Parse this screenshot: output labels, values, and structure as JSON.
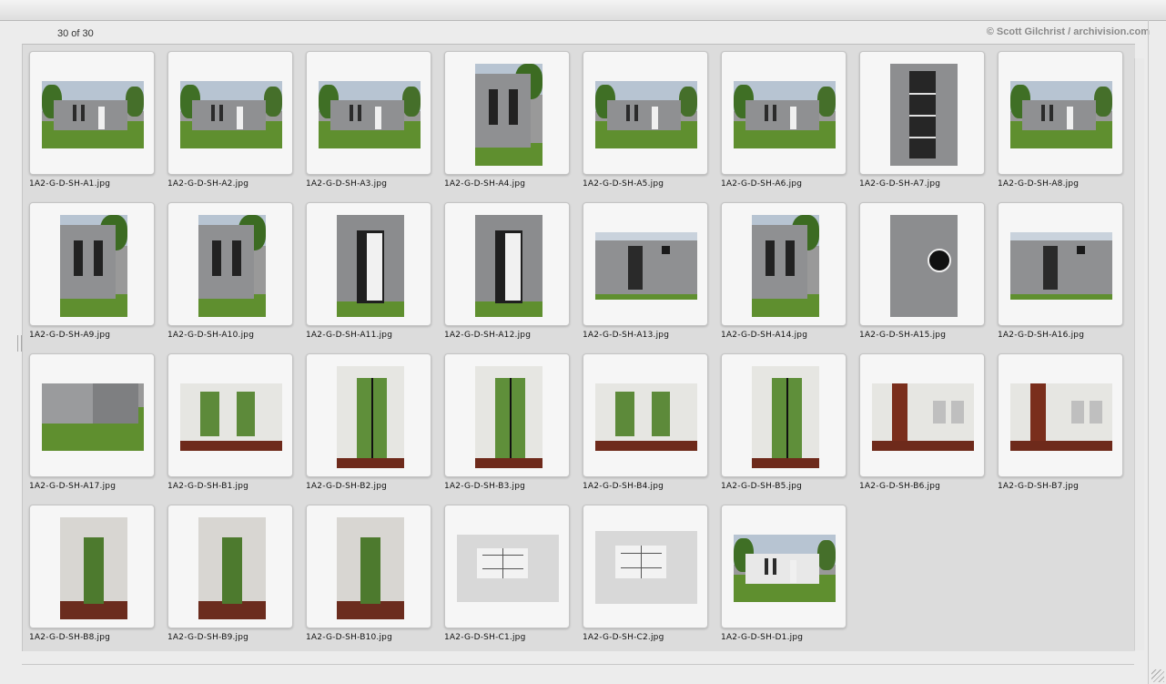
{
  "header": {
    "count_text": "30 of 30",
    "credit_text": "© Scott Gilchrist / archivision.com"
  },
  "files": [
    {
      "name": "1A2-G-D-SH-A1.jpg",
      "icon": "exterior-photo"
    },
    {
      "name": "1A2-G-D-SH-A2.jpg",
      "icon": "exterior-photo"
    },
    {
      "name": "1A2-G-D-SH-A3.jpg",
      "icon": "exterior-photo"
    },
    {
      "name": "1A2-G-D-SH-A4.jpg",
      "icon": "exterior-photo"
    },
    {
      "name": "1A2-G-D-SH-A5.jpg",
      "icon": "exterior-photo"
    },
    {
      "name": "1A2-G-D-SH-A6.jpg",
      "icon": "exterior-photo"
    },
    {
      "name": "1A2-G-D-SH-A7.jpg",
      "icon": "exterior-photo"
    },
    {
      "name": "1A2-G-D-SH-A8.jpg",
      "icon": "exterior-photo"
    },
    {
      "name": "1A2-G-D-SH-A9.jpg",
      "icon": "exterior-photo"
    },
    {
      "name": "1A2-G-D-SH-A10.jpg",
      "icon": "exterior-photo"
    },
    {
      "name": "1A2-G-D-SH-A11.jpg",
      "icon": "exterior-photo"
    },
    {
      "name": "1A2-G-D-SH-A12.jpg",
      "icon": "exterior-photo"
    },
    {
      "name": "1A2-G-D-SH-A13.jpg",
      "icon": "exterior-photo"
    },
    {
      "name": "1A2-G-D-SH-A14.jpg",
      "icon": "exterior-photo"
    },
    {
      "name": "1A2-G-D-SH-A15.jpg",
      "icon": "exterior-photo"
    },
    {
      "name": "1A2-G-D-SH-A16.jpg",
      "icon": "exterior-photo"
    },
    {
      "name": "1A2-G-D-SH-A17.jpg",
      "icon": "exterior-photo"
    },
    {
      "name": "1A2-G-D-SH-B1.jpg",
      "icon": "interior-photo"
    },
    {
      "name": "1A2-G-D-SH-B2.jpg",
      "icon": "interior-photo"
    },
    {
      "name": "1A2-G-D-SH-B3.jpg",
      "icon": "interior-photo"
    },
    {
      "name": "1A2-G-D-SH-B4.jpg",
      "icon": "interior-photo"
    },
    {
      "name": "1A2-G-D-SH-B5.jpg",
      "icon": "interior-photo"
    },
    {
      "name": "1A2-G-D-SH-B6.jpg",
      "icon": "interior-photo"
    },
    {
      "name": "1A2-G-D-SH-B7.jpg",
      "icon": "interior-photo"
    },
    {
      "name": "1A2-G-D-SH-B8.jpg",
      "icon": "interior-photo"
    },
    {
      "name": "1A2-G-D-SH-B9.jpg",
      "icon": "interior-photo"
    },
    {
      "name": "1A2-G-D-SH-B10.jpg",
      "icon": "interior-photo"
    },
    {
      "name": "1A2-G-D-SH-C1.jpg",
      "icon": "plan-photo"
    },
    {
      "name": "1A2-G-D-SH-C2.jpg",
      "icon": "plan-photo"
    },
    {
      "name": "1A2-G-D-SH-D1.jpg",
      "icon": "exterior-photo"
    }
  ],
  "colors": {
    "exterior_sky": "#b7c4d2",
    "exterior_grass": "#5f8f2f",
    "wall_gray": "#8f9092",
    "interior_wall": "#e6e6e2",
    "plan_paper": "#d8d8d8"
  }
}
